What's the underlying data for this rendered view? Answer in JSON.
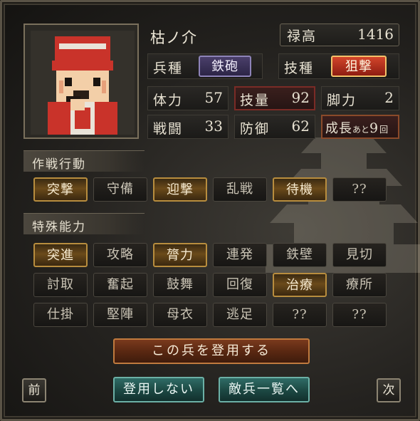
{
  "unit": {
    "name": "枯ノ介",
    "stipend_label": "禄高",
    "stipend_value": "1416",
    "troop_type_label": "兵種",
    "troop_type_value": "鉄砲",
    "skill_type_label": "技種",
    "skill_type_value": "狙撃"
  },
  "stats": {
    "hp_label": "体力",
    "hp_value": "57",
    "tech_label": "技量",
    "tech_value": "92",
    "leg_label": "脚力",
    "leg_value": "2",
    "combat_label": "戦闘",
    "combat_value": "33",
    "defense_label": "防御",
    "defense_value": "62",
    "growth_label": "成長",
    "growth_small": "あと",
    "growth_value": "9",
    "growth_unit": "回"
  },
  "tactics": {
    "title": "作戦行動",
    "buttons": [
      {
        "label": "突撃",
        "active": true
      },
      {
        "label": "守備",
        "active": false
      },
      {
        "label": "迎撃",
        "active": true
      },
      {
        "label": "乱戦",
        "active": false
      },
      {
        "label": "待機",
        "active": true
      },
      {
        "label": "??",
        "active": false
      }
    ]
  },
  "abilities": {
    "title": "特殊能力",
    "buttons": [
      {
        "label": "突進",
        "active": true
      },
      {
        "label": "攻略",
        "active": false
      },
      {
        "label": "膂力",
        "active": true
      },
      {
        "label": "連発",
        "active": false
      },
      {
        "label": "鉄壁",
        "active": false
      },
      {
        "label": "見切",
        "active": false
      },
      {
        "label": "討取",
        "active": false
      },
      {
        "label": "奮起",
        "active": false
      },
      {
        "label": "鼓舞",
        "active": false
      },
      {
        "label": "回復",
        "active": false
      },
      {
        "label": "治療",
        "active": true
      },
      {
        "label": "療所",
        "active": false
      },
      {
        "label": "仕掛",
        "active": false
      },
      {
        "label": "堅陣",
        "active": false
      },
      {
        "label": "母衣",
        "active": false
      },
      {
        "label": "逃足",
        "active": false
      },
      {
        "label": "??",
        "active": false
      },
      {
        "label": "??",
        "active": false
      }
    ]
  },
  "actions": {
    "recruit": "この兵を登用する",
    "decline": "登用しない",
    "enemy_list": "敵兵一覧へ",
    "prev": "前",
    "next": "次"
  },
  "colors": {
    "active_gold": "#b88d3e",
    "skill_red": "#d2452a",
    "troop_purple": "#4a3f6a",
    "teal_button": "#2f6c66",
    "recruit_brown": "#7a3a1d"
  }
}
